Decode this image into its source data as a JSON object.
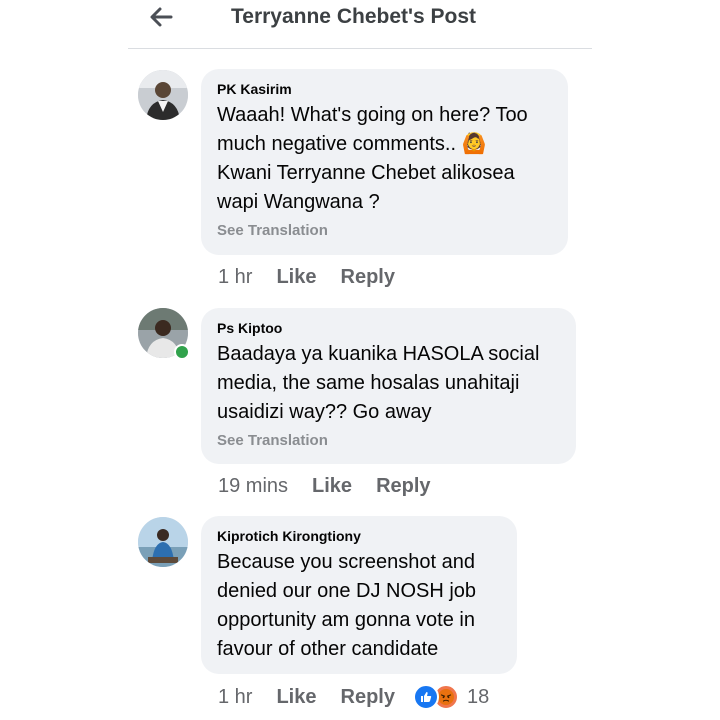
{
  "header": {
    "title": "Terryanne Chebet's Post",
    "back_icon": "arrow-left-icon"
  },
  "comments": [
    {
      "author": "PK Kasirim",
      "lines": [
        "Waaah! What's going on here? Too",
        "much negative comments.. 🙆",
        "Kwani Terryanne Chebet alikosea",
        "wapi Wangwana ?"
      ],
      "see_translation": "See Translation",
      "time": "1 hr",
      "like": "Like",
      "reply": "Reply",
      "online": false
    },
    {
      "author": "Ps Kiptoo",
      "lines": [
        "Baadaya ya kuanika HASOLA social",
        "media, the same hosalas unahitaji",
        "usaidizi way?? Go away"
      ],
      "see_translation": "See Translation",
      "time": "19 mins",
      "like": "Like",
      "reply": "Reply",
      "online": true
    },
    {
      "author": "Kiprotich Kirongtiony",
      "lines": [
        "Because you screenshot and",
        "denied our one DJ NOSH job",
        "opportunity am gonna vote in",
        "favour of other candidate"
      ],
      "time": "1 hr",
      "like": "Like",
      "reply": "Reply",
      "reaction_count": "18",
      "reactions": [
        "like-reaction-icon",
        "angry-reaction-icon"
      ],
      "online": false
    }
  ],
  "colors": {
    "bubble": "#f0f2f5",
    "meta_text": "#65676b",
    "online": "#31a24c",
    "like_blue": "#1877f2"
  }
}
